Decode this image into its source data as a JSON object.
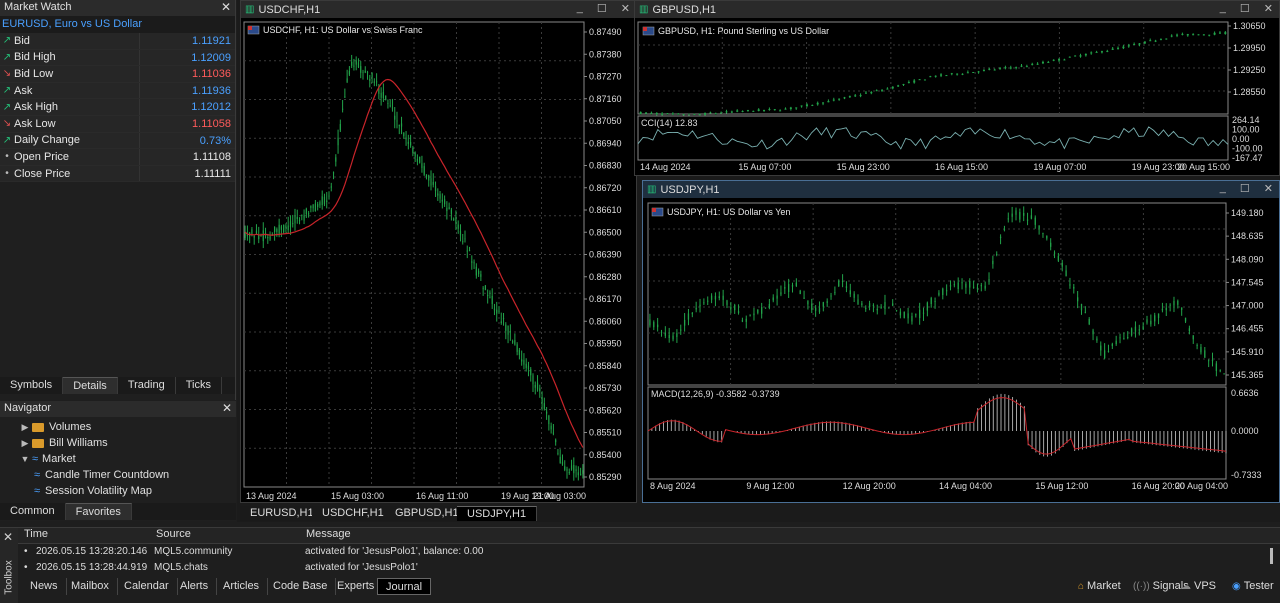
{
  "market_watch": {
    "title": "Market Watch",
    "symbol_caption": "EURUSD, Euro vs US Dollar",
    "rows": [
      {
        "name": "Bid",
        "dir": "up",
        "value": "1.11921",
        "vcolor": "blue"
      },
      {
        "name": "Bid High",
        "dir": "up",
        "value": "1.12009",
        "vcolor": "blue"
      },
      {
        "name": "Bid Low",
        "dir": "down",
        "value": "1.11036",
        "vcolor": "red"
      },
      {
        "name": "Ask",
        "dir": "up",
        "value": "1.11936",
        "vcolor": "blue"
      },
      {
        "name": "Ask High",
        "dir": "up",
        "value": "1.12012",
        "vcolor": "blue"
      },
      {
        "name": "Ask Low",
        "dir": "down",
        "value": "1.11058",
        "vcolor": "red"
      },
      {
        "name": "Daily Change",
        "dir": "up",
        "value": "0.73%",
        "vcolor": "blue"
      },
      {
        "name": "Open Price",
        "dir": "none",
        "value": "1.11108",
        "vcolor": "white"
      },
      {
        "name": "Close Price",
        "dir": "none",
        "value": "1.11111",
        "vcolor": "white"
      }
    ],
    "tabs": [
      "Symbols",
      "Details",
      "Trading",
      "Ticks"
    ],
    "active_tab": "Details"
  },
  "navigator": {
    "title": "Navigator",
    "items": [
      {
        "label": "Volumes",
        "type": "folder",
        "level": 1
      },
      {
        "label": "Bill Williams",
        "type": "folder",
        "level": 1
      },
      {
        "label": "Market",
        "type": "expanded",
        "level": 1
      },
      {
        "label": "Candle Timer Countdown",
        "type": "indicator",
        "level": 2
      },
      {
        "label": "Session Volatility Map",
        "type": "indicator",
        "level": 2
      }
    ],
    "tabs": [
      "Common",
      "Favorites"
    ],
    "active_tab": "Favorites"
  },
  "charts": {
    "usdchf": {
      "window_title": "USDCHF,H1",
      "caption": "USDCHF, H1:  US Dollar vs Swiss Franc",
      "prices": [
        "0.87490",
        "0.87380",
        "0.87270",
        "0.87160",
        "0.87050",
        "0.86940",
        "0.86830",
        "0.86720",
        "0.86610",
        "0.86500",
        "0.86390",
        "0.86280",
        "0.86170",
        "0.86060",
        "0.85950",
        "0.85840",
        "0.85730",
        "0.85620",
        "0.85510",
        "0.85400",
        "0.85290"
      ],
      "dates": [
        "13 Aug 2024",
        "15 Aug 03:00",
        "16 Aug 11:00",
        "19 Aug 19:00",
        "21 Aug 03:00"
      ]
    },
    "gbpusd": {
      "window_title": "GBPUSD,H1",
      "caption": "GBPUSD, H1:  Pound Sterling vs US Dollar",
      "prices": [
        "1.30650",
        "1.29950",
        "1.29250",
        "1.28550"
      ],
      "cci_label": "CCI(14) 12.83",
      "cci_levels": [
        "264.14",
        "100.00",
        "0.00",
        "-100.00",
        "-167.47"
      ],
      "dates": [
        "14 Aug 2024",
        "15 Aug 07:00",
        "15 Aug 23:00",
        "16 Aug 15:00",
        "19 Aug 07:00",
        "19 Aug 23:00",
        "20 Aug 15:00"
      ]
    },
    "usdjpy": {
      "window_title": "USDJPY,H1",
      "caption": "USDJPY, H1:  US Dollar vs Yen",
      "prices": [
        "149.180",
        "148.635",
        "148.090",
        "147.545",
        "147.000",
        "146.455",
        "145.910",
        "145.365"
      ],
      "macd_label": "MACD(12,26,9) -0.3582 -0.3739",
      "macd_levels": [
        "0.6636",
        "0.0000",
        "-0.7333"
      ],
      "dates": [
        "8 Aug 2024",
        "9 Aug 12:00",
        "12 Aug 20:00",
        "14 Aug 04:00",
        "15 Aug 12:00",
        "16 Aug 20:00",
        "20 Aug 04:00"
      ]
    }
  },
  "chart_tabs": [
    "EURUSD,H1",
    "USDCHF,H1",
    "GBPUSD,H1",
    "USDJPY,H1"
  ],
  "active_chart_tab": "USDJPY,H1",
  "toolbox": {
    "side_label": "Toolbox",
    "columns": [
      "Time",
      "Source",
      "Message"
    ],
    "rows": [
      {
        "time": "2026.05.15 13:28:20.146",
        "source": "MQL5.community",
        "message": "activated for 'JesusPolo1', balance: 0.00"
      },
      {
        "time": "2026.05.15 13:28:44.919",
        "source": "MQL5.chats",
        "message": "activated for 'JesusPolo1'"
      }
    ],
    "tabs": [
      "News",
      "Mailbox",
      "Calendar",
      "Alerts",
      "Articles",
      "Code Base",
      "Experts",
      "Journal"
    ],
    "active_tab": "Journal",
    "status": [
      "Market",
      "Signals",
      "VPS",
      "Tester"
    ]
  },
  "colors": {
    "bull": "#22a34a",
    "ma": "#c8242a",
    "bg": "#000000",
    "grid": "#3a3a3a",
    "accent": "#4aa0ff"
  }
}
